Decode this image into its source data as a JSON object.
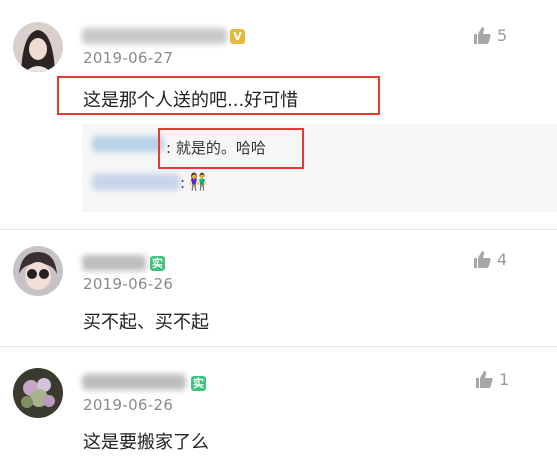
{
  "comments": [
    {
      "date": "2019-06-27",
      "text": "这是那个人送的吧...好可惜",
      "likes": "5",
      "badge": {
        "icon": "vip-badge-icon",
        "color": "#e6b93a"
      },
      "replies": [
        {
          "text": ": 就是的。哈哈"
        },
        {
          "text": ": ",
          "emoji": "👫"
        }
      ]
    },
    {
      "date": "2019-06-26",
      "text": "买不起、买不起",
      "likes": "4",
      "badge": {
        "label": "实",
        "color": "#3cc47c"
      }
    },
    {
      "date": "2019-06-26",
      "text": "这是要搬家了么",
      "likes": "1",
      "badge": {
        "label": "实",
        "color": "#3cc47c"
      }
    }
  ],
  "colors": {
    "highlight": "#e53935",
    "date": "#8a8a8a",
    "like": "#9a9a9a"
  }
}
